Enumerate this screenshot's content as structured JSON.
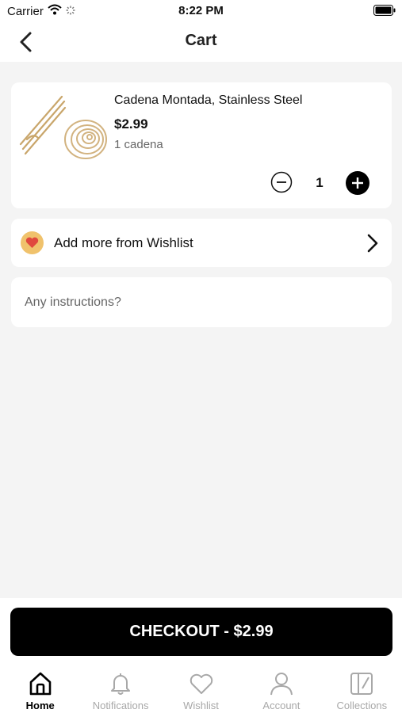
{
  "status_bar": {
    "carrier": "Carrier",
    "time": "8:22 PM"
  },
  "nav": {
    "title": "Cart"
  },
  "cart_item": {
    "name": "Cadena Montada, Stainless Steel",
    "price": "$2.99",
    "variant": "1 cadena",
    "quantity": "1"
  },
  "wishlist": {
    "label": "Add more from Wishlist"
  },
  "instructions": {
    "placeholder": "Any instructions?"
  },
  "checkout": {
    "label": "CHECKOUT - $2.99"
  },
  "tabs": [
    {
      "label": "Home",
      "icon": "home-icon",
      "active": true
    },
    {
      "label": "Notifications",
      "icon": "bell-icon",
      "active": false
    },
    {
      "label": "Wishlist",
      "icon": "heart-icon",
      "active": false
    },
    {
      "label": "Account",
      "icon": "person-icon",
      "active": false
    },
    {
      "label": "Collections",
      "icon": "collections-icon",
      "active": false
    }
  ],
  "colors": {
    "accent": "#000000",
    "background": "#f4f4f4",
    "heart_badge": "#f0c26c",
    "heart": "#e0493e",
    "inactive_tab": "#a8a8a8"
  }
}
